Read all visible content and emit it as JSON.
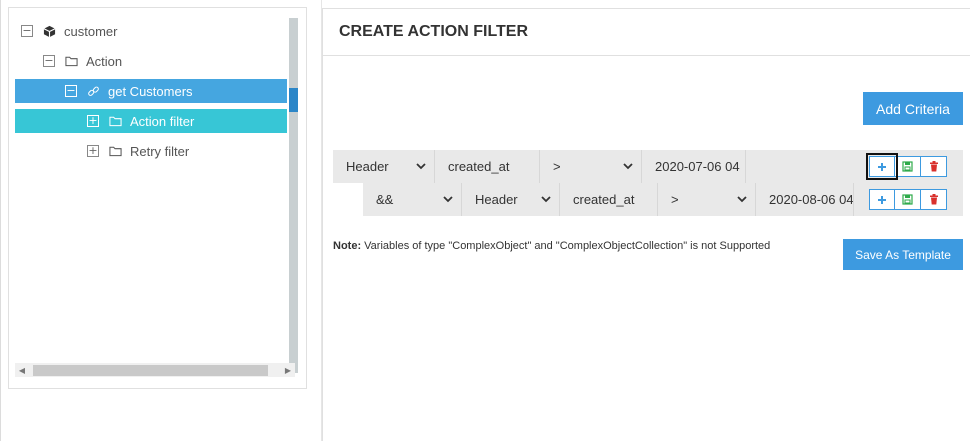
{
  "tree": {
    "items": [
      {
        "label": "customer",
        "toggle": "−",
        "icon": "cube-icon",
        "level": 0,
        "state": "normal"
      },
      {
        "label": "Action",
        "toggle": "−",
        "icon": "folder-icon",
        "level": 1,
        "state": "normal"
      },
      {
        "label": "get Customers",
        "toggle": "−",
        "icon": "link-icon",
        "level": 2,
        "state": "selected"
      },
      {
        "label": "Action filter",
        "toggle": "+",
        "icon": "folder-icon",
        "level": 3,
        "state": "hover"
      },
      {
        "label": "Retry filter",
        "toggle": "+",
        "icon": "folder-icon",
        "level": 3,
        "state": "normal"
      }
    ]
  },
  "panel": {
    "title": "CREATE ACTION FILTER",
    "add_criteria_label": "Add Criteria",
    "save_template_label": "Save As Template",
    "note_label": "Note:",
    "note_text": " Variables of type \"ComplexObject\" and \"ComplexObjectCollection\" is not Supported"
  },
  "criteria": [
    {
      "source": "Header",
      "field": "created_at",
      "operator": ">",
      "value": "2020-07-06 04"
    },
    {
      "logic": "&&",
      "source": "Header",
      "field": "created_at",
      "operator": ">",
      "value": "2020-08-06 04"
    }
  ],
  "colors": {
    "primary": "#3d9ae0",
    "selected": "#45a6e0",
    "hover": "#37c6d6",
    "save_green": "#2eaa4a",
    "delete_red": "#d9302c"
  }
}
